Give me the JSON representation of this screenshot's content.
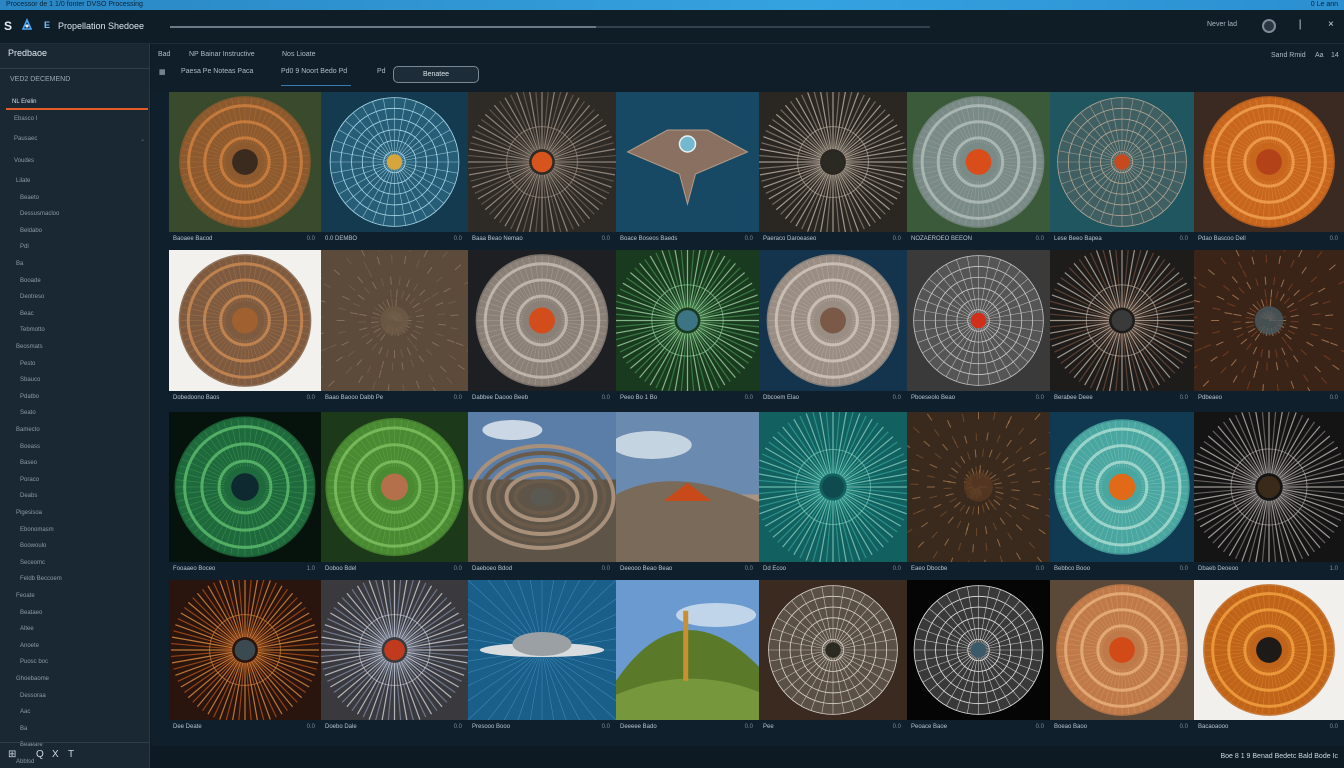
{
  "top_strip": {
    "left": "Processor de 1 1/0 fonter DVSO Processing",
    "right": "0 Le ann"
  },
  "titlebar": {
    "logo": "S",
    "icon_left": "app-logo-icon",
    "brand_letter": "E",
    "app_name": "Propellation Shedoee",
    "right_label": "Never lad",
    "progress": 0.56
  },
  "sidebar": {
    "header": "Predbaoe",
    "section_title": "VED2 DECEMEND",
    "active_item": "NL Erelin",
    "sub_items": [
      "Ebasco I",
      "Pausaec"
    ],
    "group_title": "Voudes",
    "items": [
      "Lilate",
      "Beaeto",
      "Dessusmacloo",
      "Beldabo",
      "Pdl",
      "Ba",
      "Booade",
      "Deotreso",
      "Beac",
      "Tebmotto",
      "Beosmats",
      "Pesto",
      "Sbauco",
      "Pdatbo",
      "Seato",
      "Bamecto",
      "Boeass",
      "Baseo",
      "Poraco",
      "Deabs",
      "Pigesisoa",
      "Ebonomasm",
      "Boowoulo",
      "Seceomc",
      "Feldb Beccoem",
      "Feoate",
      "Beataeo",
      "Altee",
      "Anoete",
      "Puosc boc",
      "Ghoebaome",
      "Dessoraa",
      "Aac",
      "Ba",
      "Beaeare",
      "Abblsd"
    ],
    "bottom_icons": [
      "grid-icon",
      "search-icon",
      "close-icon",
      "text-icon"
    ],
    "bottom_glyphs": [
      "⊞",
      "Q",
      "X",
      "T"
    ]
  },
  "toolbar": {
    "label_a": "Bad",
    "label_b": "NP Bainar Instructive",
    "label_c": "Nos Lioate",
    "label_d": "Paesa Pe Noteas Paca",
    "label_e": "Pd0 9 Noort Bedo Pd",
    "label_f": "Pd",
    "button_label": "Benatee",
    "right_label": "Sand Rmid",
    "right_nums": [
      "Aa",
      "14"
    ]
  },
  "captions": [
    [
      "Baoaee Bacod",
      "0.0 DEMBO",
      "Baaa Beao Nemao",
      "Boace Boseos Baeds",
      "Paeraco Daroeaseo",
      "NOZAEROEO BEEON",
      "Lese Beeo Bapea",
      "Pdao Bascoo Dell"
    ],
    [
      "Dobedoono Baos",
      "Baao Baooo Dabb Pe",
      "Dabbee Daooo Beeb",
      "Peeo Bo 1 Bo",
      "Dbcoem Elao",
      "Pboeseolo Beao",
      "Berabee Deee",
      "Pdbeaeo"
    ],
    [
      "Fooaaeo Boceo",
      "Doboo Bdel",
      "Daeboeo Bdod",
      "Deeooo Beao Beao",
      "Dd Ecoo",
      "Eaeo Dbocbe",
      "Bebbco Booo",
      "Dbaeb Deoeoo"
    ],
    [
      "Dee Deate",
      "Doebo Dale",
      "Presooo Booo",
      "Deeeee Bado",
      "Pee",
      "Peoace Baoe",
      "Boeao Baoo",
      "Bacaoaooo"
    ]
  ],
  "caption_nums": [
    [
      "0.0",
      "0.0",
      "0.0",
      "0.0",
      "0.0",
      "0.0",
      "0.0",
      "0.0"
    ],
    [
      "0.0",
      "0.0",
      "0.0",
      "0.0",
      "0.0",
      "0.0",
      "0.0",
      "0.0"
    ],
    [
      "1.0",
      "0.0",
      "0.0",
      "0.0",
      "0.0",
      "0.0",
      "0.0",
      "1.0"
    ],
    [
      "0.0",
      "0.0",
      "0.0",
      "0.0",
      "0.0",
      "0.0",
      "0.0",
      "0.0"
    ]
  ],
  "status": "Boe 8 1 9 Benad Bedetc Bald Bode Ic",
  "thumbnails": [
    [
      {
        "bg": "#3a4a2c",
        "ring": "#8c5a2e",
        "ring2": "#cf8040",
        "core": "#3b2a1e",
        "style": "disc"
      },
      {
        "bg": "#143a4f",
        "ring": "#4aa3c2",
        "ring2": "#a9d8ea",
        "core": "#d6a63c",
        "style": "web"
      },
      {
        "bg": "#2e2a26",
        "ring": "#6d6258",
        "ring2": "#a89a8b",
        "core": "#d8541e",
        "style": "rays"
      },
      {
        "bg": "#174864",
        "ring": "#8a7060",
        "ring2": "#b59a86",
        "core": "#74b8cf",
        "style": "craft"
      },
      {
        "bg": "#2a2622",
        "ring": "#8a7f72",
        "ring2": "#c0b4a5",
        "core": "#2a2a22",
        "style": "rays"
      },
      {
        "bg": "#3b5a3a",
        "ring": "#7a8a86",
        "ring2": "#b0bcb8",
        "core": "#d94d1a",
        "style": "disc"
      },
      {
        "bg": "#1f5660",
        "ring": "#7a7066",
        "ring2": "#b7a796",
        "core": "#c74a1e",
        "style": "web"
      },
      {
        "bg": "#3a2a22",
        "ring": "#c8661e",
        "ring2": "#f0a050",
        "core": "#b44218",
        "style": "disc"
      }
    ],
    [
      {
        "bg": "#f3f1ee",
        "ring": "#7e5b40",
        "ring2": "#c98a54",
        "core": "#a06030",
        "style": "disc"
      },
      {
        "bg": "#5c4a3a",
        "ring": "#7d6a56",
        "ring2": "#9a8672",
        "core": "#6e5a46",
        "style": "fur"
      },
      {
        "bg": "#1d1f22",
        "ring": "#8a8078",
        "ring2": "#c6bcb2",
        "core": "#d24c1c",
        "style": "disc"
      },
      {
        "bg": "#1a3a1f",
        "ring": "#3f8a4a",
        "ring2": "#9ed4a3",
        "core": "#3c7486",
        "style": "rays"
      },
      {
        "bg": "#14344e",
        "ring": "#9a8e84",
        "ring2": "#cfc5bb",
        "core": "#7a5a46",
        "style": "disc"
      },
      {
        "bg": "#3a3a3a",
        "ring": "#8a8a8a",
        "ring2": "#cacaca",
        "core": "#d0301a",
        "style": "web"
      },
      {
        "bg": "#1e1c1a",
        "ring": "#6a4a38",
        "ring2": "#c0b4a8",
        "core": "#3a3a3a",
        "style": "rays"
      },
      {
        "bg": "#3a2418",
        "ring": "#9a4a22",
        "ring2": "#d8a070",
        "core": "#4a5a62",
        "style": "fur"
      }
    ],
    [
      {
        "bg": "#06120c",
        "ring": "#1f6a3c",
        "ring2": "#5cba6c",
        "core": "#0e2a30",
        "style": "disc"
      },
      {
        "bg": "#1c3a1a",
        "ring": "#4a8a32",
        "ring2": "#7cc060",
        "core": "#b4704a",
        "style": "disc"
      },
      {
        "bg": "#5a7ea8",
        "ring": "#6a5a4a",
        "ring2": "#a8907a",
        "core": "#5a5a52",
        "style": "land"
      },
      {
        "bg": "#6a8ab0",
        "ring": "#7a6a5a",
        "ring2": "#a89480",
        "core": "#c84a1a",
        "style": "hill"
      },
      {
        "bg": "#136060",
        "ring": "#2e9e92",
        "ring2": "#7ed0c0",
        "core": "#0e4a4e",
        "style": "rays"
      },
      {
        "bg": "#3a2a1e",
        "ring": "#8a5a32",
        "ring2": "#c8905a",
        "core": "#5a3a22",
        "style": "fur"
      },
      {
        "bg": "#0f3a52",
        "ring": "#4aa6a0",
        "ring2": "#a8dcd0",
        "core": "#e06a18",
        "style": "disc"
      },
      {
        "bg": "#141414",
        "ring": "#7a7472",
        "ring2": "#c0bab6",
        "core": "#3a2a1a",
        "style": "rays"
      }
    ],
    [
      {
        "bg": "#2a140e",
        "ring": "#b0501a",
        "ring2": "#e09040",
        "core": "#3a4a50",
        "style": "rays"
      },
      {
        "bg": "#3a3a3e",
        "ring": "#7a86a0",
        "ring2": "#d0d4de",
        "core": "#c03a1e",
        "style": "rays"
      },
      {
        "bg": "#1a5e8a",
        "ring": "#9aa0a4",
        "ring2": "#d8dcdf",
        "core": "#3a4a5a",
        "style": "ufo"
      },
      {
        "bg": "#6a9ad0",
        "ring": "#5a7a2a",
        "ring2": "#8aaa4a",
        "core": "#c89030",
        "style": "mound"
      },
      {
        "bg": "#3a2a20",
        "ring": "#9a9890",
        "ring2": "#dad6cc",
        "core": "#2a2a22",
        "style": "web"
      },
      {
        "bg": "#050505",
        "ring": "#9a9a9a",
        "ring2": "#e4e4e4",
        "core": "#3a5a6a",
        "style": "web"
      },
      {
        "bg": "#5a4838",
        "ring": "#c07a4a",
        "ring2": "#e8b07a",
        "core": "#d24a18",
        "style": "disc"
      },
      {
        "bg": "#f2f0ec",
        "ring": "#c0641a",
        "ring2": "#f0a040",
        "core": "#1e1a18",
        "style": "disc"
      }
    ]
  ]
}
